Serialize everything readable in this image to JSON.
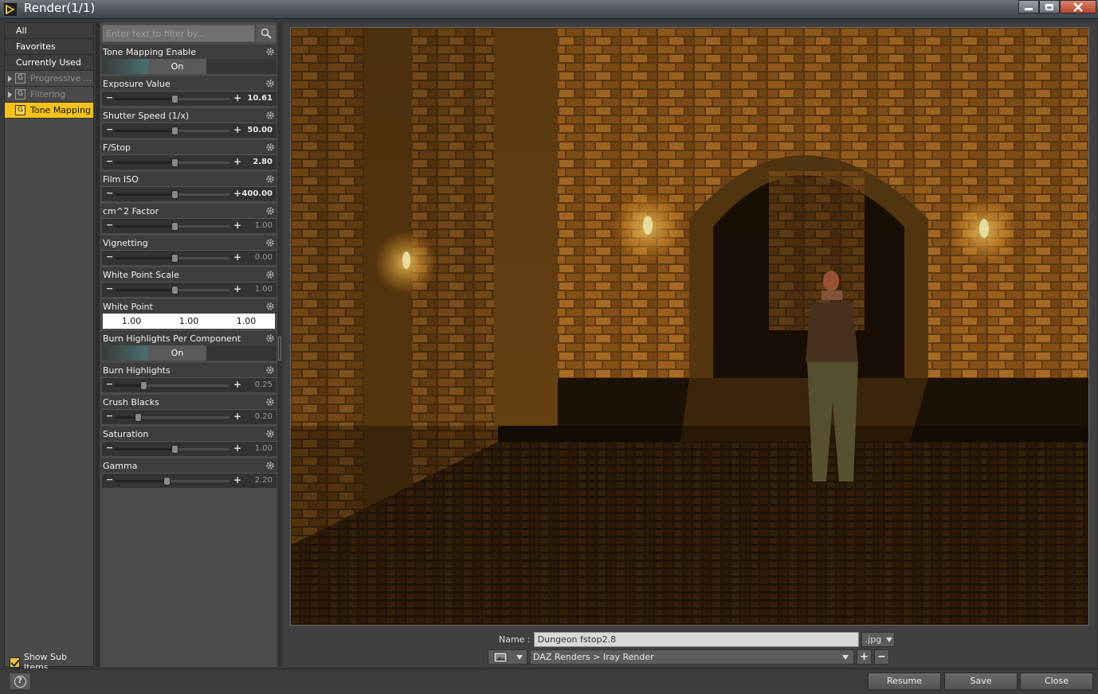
{
  "window": {
    "title": "Render(1/1)"
  },
  "categories": [
    {
      "label": "All",
      "kind": "top"
    },
    {
      "label": "Favorites",
      "kind": "top"
    },
    {
      "label": "Currently Used",
      "kind": "top"
    },
    {
      "label": "Progressive ...",
      "kind": "group",
      "icon": "G"
    },
    {
      "label": "Filtering",
      "kind": "group",
      "icon": "G"
    },
    {
      "label": "Tone Mapping",
      "kind": "group",
      "icon": "G",
      "selected": true
    }
  ],
  "show_sub_items": {
    "label": "Show Sub Items",
    "checked": true
  },
  "filter": {
    "placeholder": "Enter text to filter by..."
  },
  "properties": [
    {
      "label": "Tone Mapping Enable",
      "type": "toggle",
      "value": "On"
    },
    {
      "label": "Exposure Value",
      "type": "slider",
      "value": "10.61",
      "position": 0.52,
      "bold": true
    },
    {
      "label": "Shutter Speed (1/x)",
      "type": "slider",
      "value": "50.00",
      "position": 0.52,
      "bold": true
    },
    {
      "label": "F/Stop",
      "type": "slider",
      "value": "2.80",
      "position": 0.52,
      "bold": true
    },
    {
      "label": "Film ISO",
      "type": "slider",
      "value": "400.00",
      "position": 0.52,
      "bold": true
    },
    {
      "label": "cm^2 Factor",
      "type": "slider",
      "value": "1.00",
      "position": 0.52,
      "bold": false
    },
    {
      "label": "Vignetting",
      "type": "slider",
      "value": "0.00",
      "position": 0.52,
      "bold": false
    },
    {
      "label": "White Point Scale",
      "type": "slider",
      "value": "1.00",
      "position": 0.52,
      "bold": false
    },
    {
      "label": "White Point",
      "type": "triple",
      "values": [
        "1.00",
        "1.00",
        "1.00"
      ]
    },
    {
      "label": "Burn Highlights Per Component",
      "type": "toggle",
      "value": "On"
    },
    {
      "label": "Burn Highlights",
      "type": "slider",
      "value": "0.25",
      "position": 0.25,
      "bold": false
    },
    {
      "label": "Crush Blacks",
      "type": "slider",
      "value": "0.20",
      "position": 0.2,
      "bold": false
    },
    {
      "label": "Saturation",
      "type": "slider",
      "value": "1.00",
      "position": 0.52,
      "bold": false
    },
    {
      "label": "Gamma",
      "type": "slider",
      "value": "2.20",
      "position": 0.45,
      "bold": false
    }
  ],
  "output": {
    "name_label": "Name :",
    "name_value": "Dungeon fstop2.8",
    "extension": ".jpg",
    "path": "DAZ Renders > Iray Render"
  },
  "buttons": {
    "resume": "Resume",
    "save": "Save",
    "close": "Close"
  },
  "colors": {
    "accent": "#f4c21a",
    "panel": "#4b4b4b"
  }
}
